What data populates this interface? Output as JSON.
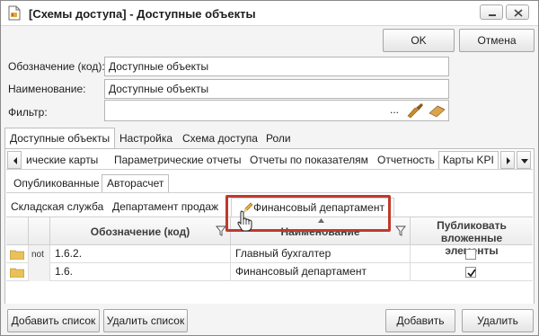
{
  "window": {
    "title": "[Схемы доступа] - Доступные объекты"
  },
  "dialog": {
    "ok_label": "OK",
    "cancel_label": "Отмена"
  },
  "form": {
    "code_label": "Обозначение (код):",
    "code_value": "Доступные объекты",
    "name_label": "Наименование:",
    "name_value": "Доступные объекты",
    "filter_label": "Фильтр:",
    "filter_value": "",
    "filter_ellipsis": "..."
  },
  "main_tabs": [
    {
      "label": "Доступные объекты",
      "active": true
    },
    {
      "label": "Настройка",
      "active": false
    },
    {
      "label": "Схема доступа",
      "active": false
    },
    {
      "label": "Роли",
      "active": false
    }
  ],
  "sub_tabs": [
    {
      "label": "ические карты",
      "active": false
    },
    {
      "label": "Параметрические отчеты",
      "active": false
    },
    {
      "label": "Отчеты по показателям",
      "active": false
    },
    {
      "label": "Отчетность",
      "active": false
    },
    {
      "label": "Карты KPI",
      "active": true
    }
  ],
  "type_tabs": [
    {
      "label": "Опубликованные",
      "active": false
    },
    {
      "label": "Авторасчет",
      "active": true
    }
  ],
  "dept_tabs": [
    {
      "label": "Складская служба",
      "active": false
    },
    {
      "label": "Департамент продаж",
      "active": false
    },
    {
      "label": "Финансовый департамент",
      "active": true
    }
  ],
  "grid": {
    "columns": {
      "code": "Обозначение (код)",
      "name": "Наименование",
      "publish": "Публиковать вложенные элементы"
    },
    "rows": [
      {
        "not": "not",
        "code": "1.6.2.",
        "name": "Главный бухгалтер",
        "publish": false
      },
      {
        "not": "",
        "code": "1.6.",
        "name": "Финансовый департамент",
        "publish": true
      }
    ]
  },
  "footer": {
    "add_list": "Добавить список",
    "remove_list": "Удалить список",
    "add": "Добавить",
    "remove": "Удалить"
  },
  "colors": {
    "highlight": "#c0392b",
    "folder": "#e8c15a"
  }
}
